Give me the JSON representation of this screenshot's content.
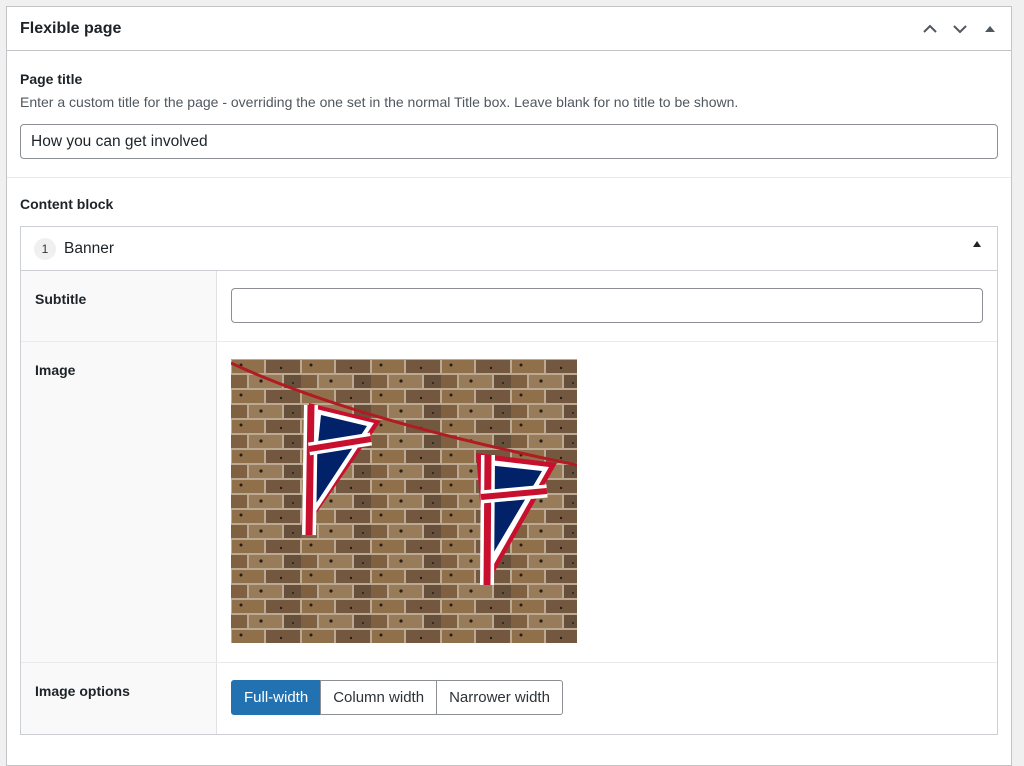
{
  "metabox": {
    "title": "Flexible page"
  },
  "page_title_field": {
    "label": "Page title",
    "description": "Enter a custom title for the page - overriding the one set in the normal Title box. Leave blank for no title to be shown.",
    "value": "How you can get involved"
  },
  "content_block": {
    "label": "Content block",
    "layout": {
      "order": "1",
      "name": "Banner",
      "fields": {
        "subtitle_label": "Subtitle",
        "subtitle_value": "",
        "image_label": "Image",
        "image_options_label": "Image options",
        "image_options": [
          "Full-width",
          "Column width",
          "Narrower width"
        ],
        "image_options_selected": "Full-width"
      }
    }
  },
  "colors": {
    "accent": "#2271b1",
    "border": "#c3c4c7"
  }
}
